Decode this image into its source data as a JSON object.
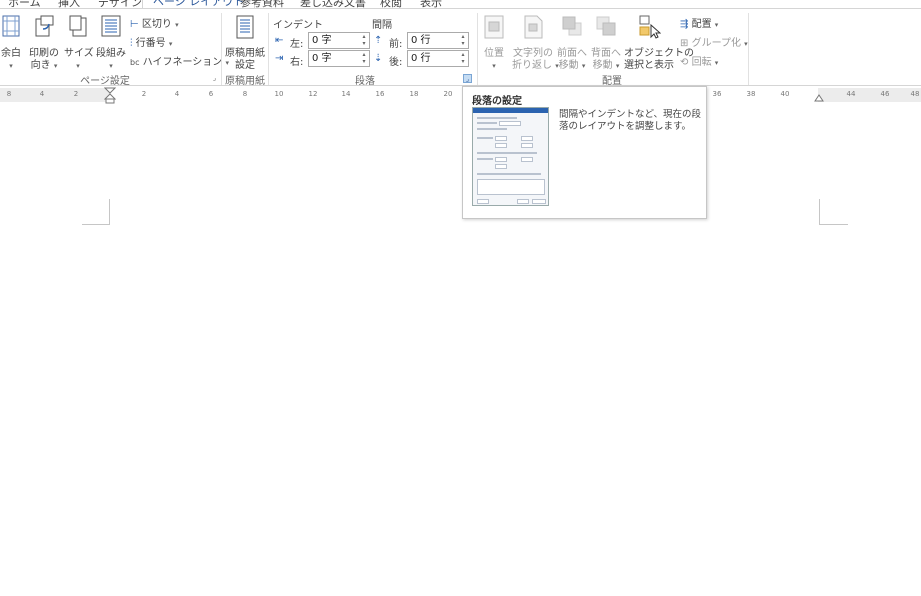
{
  "tabs": [
    "ホーム",
    "挿入",
    "デザイン",
    "ページ レイアウト",
    "参考資料",
    "差し込み文書",
    "校閲",
    "表示"
  ],
  "page_setup": {
    "margins": "余白",
    "orientation_1": "印刷の",
    "orientation_2": "向き",
    "size": "サイズ",
    "columns": "段組み",
    "breaks": "区切り",
    "line_numbers": "行番号",
    "hyphenation": "ハイフネーション",
    "group_label": "ページ設定"
  },
  "manuscript": {
    "btn_1": "原稿用紙",
    "btn_2": "設定",
    "group_label": "原稿用紙"
  },
  "paragraph": {
    "indent_header": "インデント",
    "spacing_header": "間隔",
    "left_label": "左:",
    "left_value": "0 字",
    "right_label": "右:",
    "right_value": "0 字",
    "before_label": "前:",
    "before_value": "0 行",
    "after_label": "後:",
    "after_value": "0 行",
    "group_label": "段落"
  },
  "arrange": {
    "position": "位置",
    "wrap_1": "文字列の",
    "wrap_2": "折り返し",
    "forward_1": "前面へ",
    "forward_2": "移動",
    "backward_1": "背面へ",
    "backward_2": "移動",
    "selection_1": "オブジェクトの",
    "selection_2": "選択と表示",
    "align": "配置",
    "group": "グループ化",
    "rotate": "回転",
    "group_label": "配置"
  },
  "ruler_ticks": [
    "8",
    "4",
    "2",
    "2",
    "4",
    "6",
    "8",
    "10",
    "12",
    "14",
    "16",
    "18",
    "20",
    "36",
    "38",
    "40",
    "44",
    "46",
    "48"
  ],
  "tooltip": {
    "title": "段落の設定",
    "description": "間隔やインデントなど、現在の段落のレイアウトを調整します。"
  }
}
